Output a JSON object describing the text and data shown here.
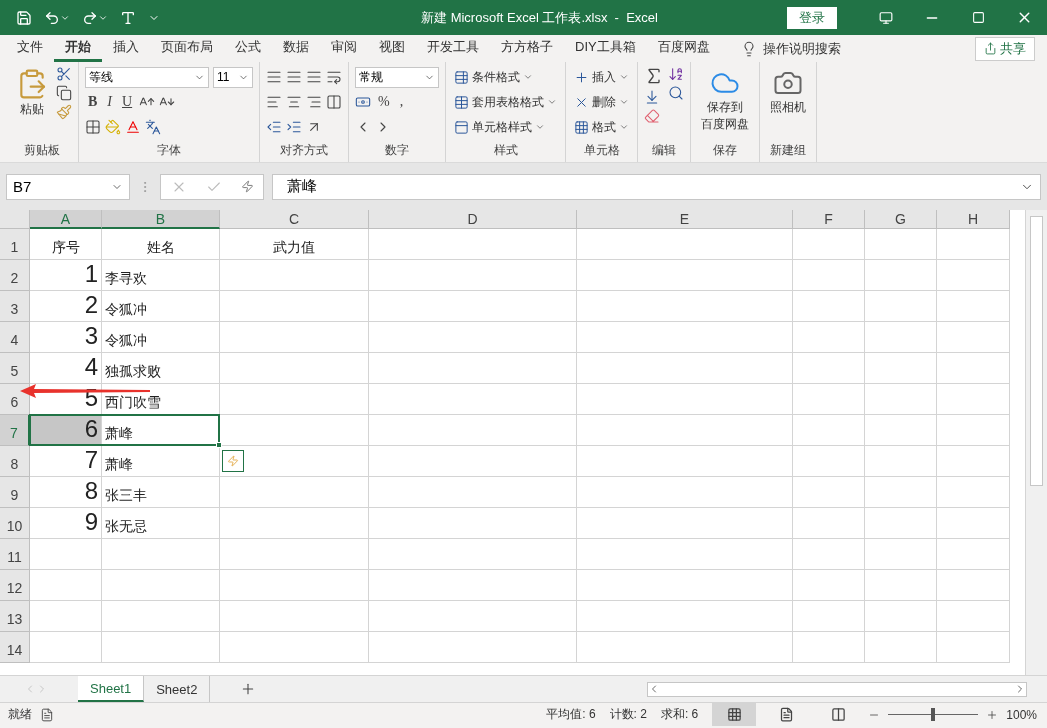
{
  "title_bar": {
    "title": "新建 Microsoft Excel 工作表.xlsx  -  Excel",
    "login": "登录"
  },
  "menu_tabs": [
    {
      "label": "文件",
      "selected": false
    },
    {
      "label": "开始",
      "selected": true
    },
    {
      "label": "插入",
      "selected": false
    },
    {
      "label": "页面布局",
      "selected": false
    },
    {
      "label": "公式",
      "selected": false
    },
    {
      "label": "数据",
      "selected": false
    },
    {
      "label": "审阅",
      "selected": false
    },
    {
      "label": "视图",
      "selected": false
    },
    {
      "label": "开发工具",
      "selected": false
    },
    {
      "label": "方方格子",
      "selected": false
    },
    {
      "label": "DIY工具箱",
      "selected": false
    },
    {
      "label": "百度网盘",
      "selected": false
    }
  ],
  "tell_me": "操作说明搜索",
  "share": "共享",
  "ribbon": [
    {
      "kind": "clipboard",
      "label": "剪贴板",
      "paste": "粘贴"
    },
    {
      "kind": "font",
      "label": "字体",
      "font": "等线",
      "size": "11",
      "styles": [
        "B",
        "I",
        "U"
      ]
    },
    {
      "kind": "alignment",
      "label": "对齐方式"
    },
    {
      "kind": "number",
      "label": "数字",
      "format": "常规",
      "symbols": [
        "%",
        ","
      ]
    },
    {
      "kind": "styles",
      "label": "样式",
      "items": [
        "条件格式",
        "套用表格格式",
        "单元格样式"
      ]
    },
    {
      "kind": "cells",
      "label": "单元格",
      "items": [
        "插入",
        "删除",
        "格式"
      ]
    },
    {
      "kind": "editing",
      "label": "编辑"
    },
    {
      "kind": "cloud_save",
      "label": "保存",
      "button": [
        "保存到",
        "百度网盘"
      ]
    },
    {
      "kind": "camera",
      "label": "新建组",
      "button": [
        "照相机"
      ]
    }
  ],
  "formula_bar": {
    "name_box": "B7",
    "formula": "萧峰"
  },
  "columns": [
    {
      "label": "A",
      "selected": true,
      "active": false
    },
    {
      "label": "B",
      "selected": true,
      "active": true
    },
    {
      "label": "C",
      "selected": false,
      "active": false
    },
    {
      "label": "D",
      "selected": false,
      "active": false
    },
    {
      "label": "E",
      "selected": false,
      "active": false
    },
    {
      "label": "F",
      "selected": false,
      "active": false
    },
    {
      "label": "G",
      "selected": false,
      "active": false
    },
    {
      "label": "H",
      "selected": false,
      "active": false
    }
  ],
  "rows": [
    {
      "label": "1",
      "selected": false,
      "kind": "header",
      "cells": {
        "A": "序号",
        "B": "姓名",
        "C": "武力值"
      }
    },
    {
      "label": "2",
      "selected": false,
      "kind": "data",
      "cells": {
        "A": "1",
        "B": "李寻欢"
      }
    },
    {
      "label": "3",
      "selected": false,
      "kind": "data",
      "cells": {
        "A": "2",
        "B": "令狐冲"
      }
    },
    {
      "label": "4",
      "selected": false,
      "kind": "data",
      "cells": {
        "A": "3",
        "B": "令狐冲"
      }
    },
    {
      "label": "5",
      "selected": false,
      "kind": "data",
      "cells": {
        "A": "4",
        "B": "独孤求败"
      }
    },
    {
      "label": "6",
      "selected": false,
      "kind": "data",
      "cells": {
        "A": "5",
        "B": "西门吹雪"
      }
    },
    {
      "label": "7",
      "selected": true,
      "kind": "data",
      "cells": {
        "A": "6",
        "B": "萧峰"
      }
    },
    {
      "label": "8",
      "selected": false,
      "kind": "data",
      "cells": {
        "A": "7",
        "B": "萧峰"
      }
    },
    {
      "label": "9",
      "selected": false,
      "kind": "data",
      "cells": {
        "A": "8",
        "B": "张三丰"
      }
    },
    {
      "label": "10",
      "selected": false,
      "kind": "data",
      "cells": {
        "A": "9",
        "B": "张无忌"
      }
    },
    {
      "label": "11",
      "selected": false,
      "kind": "data"
    },
    {
      "label": "12",
      "selected": false,
      "kind": "data"
    },
    {
      "label": "13",
      "selected": false,
      "kind": "data"
    },
    {
      "label": "14",
      "selected": false,
      "kind": "data"
    }
  ],
  "sheets": [
    {
      "label": "Sheet1",
      "selected": true
    },
    {
      "label": "Sheet2",
      "selected": false
    }
  ],
  "status_bar": {
    "ready": "就绪",
    "stats": [
      "平均值: 6",
      "计数: 2",
      "求和: 6"
    ],
    "views": [
      {
        "selected": true
      },
      {
        "selected": false
      },
      {
        "selected": false
      }
    ],
    "zoom": "100%",
    "zoom_slider": {
      "level": 0.5
    }
  }
}
